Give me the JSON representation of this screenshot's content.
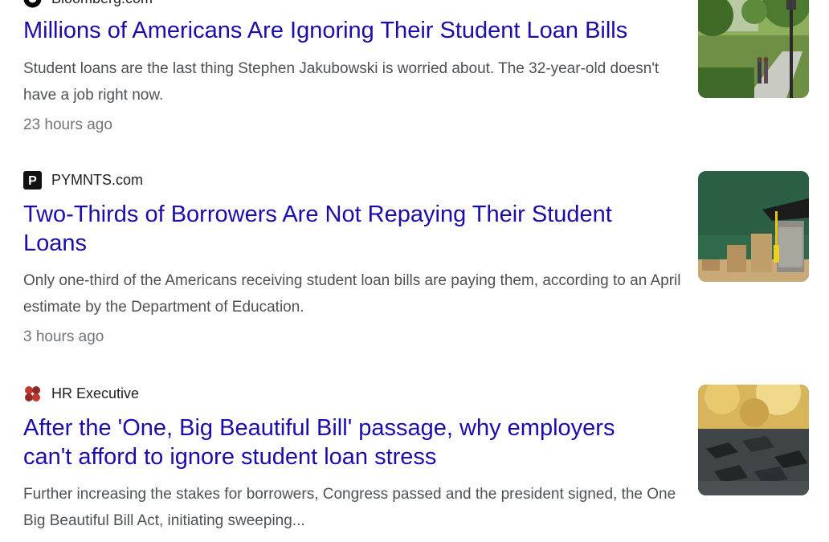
{
  "articles": [
    {
      "source": "Bloomberg.com",
      "favicon_icon": "bloomberg-logo-icon",
      "title": "Millions of Americans Are Ignoring Their Student Loan Bills",
      "snippet": "Student loans are the last thing Stephen Jakubowski is worried about. The 32-year-old doesn't have a job right now.",
      "time": "23 hours ago",
      "thumbnail": "campus-path-trees-image"
    },
    {
      "source": "PYMNTS.com",
      "favicon_icon": "pymnts-p-logo-icon",
      "title": "Two-Thirds of Borrowers Are Not Repaying Their Student Loans",
      "snippet": "Only one-third of the Americans receiving student loan bills are paying them, according to an April estimate by the Department of Education.",
      "time": "3 hours ago",
      "thumbnail": "coins-graduation-cap-image"
    },
    {
      "source": "HR Executive",
      "favicon_icon": "hr-executive-logo-icon",
      "title": "After the 'One, Big Beautiful Bill' passage, why employers can't afford to ignore student loan stress",
      "snippet": "Further increasing the stakes for borrowers, Congress passed and the president signed, the One Big Beautiful Bill Act, initiating sweeping...",
      "time": "",
      "thumbnail": "graduation-caps-crowd-image"
    }
  ],
  "colors": {
    "link": "#1a0dab",
    "snippet": "#4d5156",
    "meta": "#70757a"
  }
}
